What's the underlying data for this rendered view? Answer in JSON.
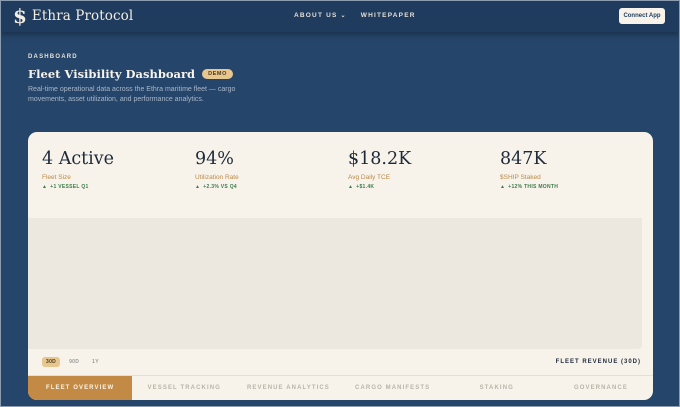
{
  "nav": {
    "brand": "Ethra Protocol",
    "brand_icon": "$",
    "links": [
      {
        "label": "ABOUT US",
        "has_dropdown": true
      },
      {
        "label": "WHITEPAPER",
        "has_dropdown": false
      }
    ],
    "cta": "Connect App"
  },
  "header": {
    "eyebrow": "DASHBOARD",
    "title": "Fleet Visibility Dashboard",
    "badge": "DEMO",
    "subtitle": "Real-time operational data across the Ethra maritime fleet — cargo movements, asset utilization, and performance analytics."
  },
  "stats": [
    {
      "value": "4 Active",
      "label": "Fleet Size",
      "delta": "+1 VESSEL Q1"
    },
    {
      "value": "94%",
      "label": "Utilization Rate",
      "delta": "+2.3% VS Q4"
    },
    {
      "value": "$18.2K",
      "label": "Avg Daily TCE",
      "delta": "+$1.4K"
    },
    {
      "value": "847K",
      "label": "$SHIP Staked",
      "delta": "+12% THIS MONTH"
    }
  ],
  "chart": {
    "ranges": [
      "30D",
      "90D",
      "1Y"
    ],
    "selected_range": "30D",
    "caption": "FLEET REVENUE (30D)"
  },
  "tabs": [
    {
      "label": "FLEET OVERVIEW",
      "active": true
    },
    {
      "label": "VESSEL TRACKING",
      "active": false
    },
    {
      "label": "REVENUE ANALYTICS",
      "active": false
    },
    {
      "label": "CARGO MANIFESTS",
      "active": false
    },
    {
      "label": "STAKING",
      "active": false
    },
    {
      "label": "GOVERNANCE",
      "active": false
    }
  ],
  "colors": {
    "background": "#25456a",
    "nav": "#1f3b5e",
    "card": "#f7f3ea",
    "accent": "#c38a46",
    "badge": "#e8c78f",
    "positive": "#3d7a4a"
  },
  "icons": {
    "brand": "dollar-logo-icon",
    "dropdown": "chevron-down-icon",
    "delta": "arrow-up-icon"
  }
}
